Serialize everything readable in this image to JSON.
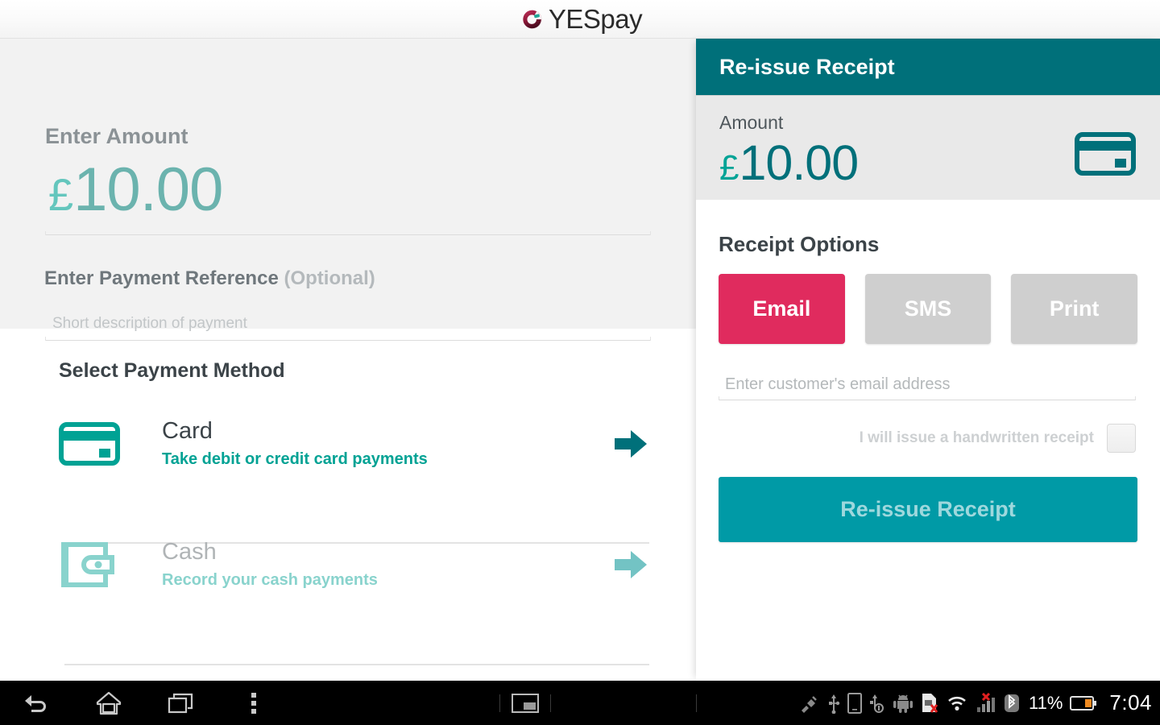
{
  "brand": {
    "logo_icon": "yespay-logo-icon",
    "name": "YESpay"
  },
  "left": {
    "amount_label": "Enter Amount",
    "amount_currency": "£",
    "amount_value": "10.00",
    "reference_label": "Enter Payment Reference",
    "reference_optional": "(Optional)",
    "reference_placeholder": "Short description of payment",
    "reference_value": "",
    "select_method_label": "Select Payment Method",
    "methods": [
      {
        "icon": "credit-card-icon",
        "title": "Card",
        "subtitle": "Take debit or credit card payments",
        "arrow_icon": "arrow-right-icon",
        "enabled": true,
        "color": "#00a294"
      },
      {
        "icon": "wallet-icon",
        "title": "Cash",
        "subtitle": "Record your cash payments",
        "arrow_icon": "arrow-right-icon",
        "enabled": false,
        "color": "#89d3cd"
      }
    ]
  },
  "right": {
    "header_title": "Re-issue Receipt",
    "amount_label": "Amount",
    "amount_currency": "£",
    "amount_value": "10.00",
    "card_icon": "credit-card-icon",
    "options_label": "Receipt Options",
    "options": [
      {
        "label": "Email",
        "selected": true
      },
      {
        "label": "SMS",
        "selected": false
      },
      {
        "label": "Print",
        "selected": false
      }
    ],
    "email_placeholder": "Enter customer's email address",
    "email_value": "",
    "handwritten_label": "I will issue a handwritten receipt",
    "handwritten_checked": false,
    "submit_label": "Re-issue Receipt"
  },
  "system_bar": {
    "nav": [
      {
        "icon": "back-icon",
        "label": "Back"
      },
      {
        "icon": "home-icon",
        "label": "Home"
      },
      {
        "icon": "recents-icon",
        "label": "Recent apps"
      },
      {
        "icon": "overflow-menu-icon",
        "label": "Menu"
      }
    ],
    "mid_icon": "screenshot-icon",
    "status_icons": [
      "plug-icon",
      "usb-icon",
      "tablet-icon",
      "usb-debug-icon",
      "android-icon",
      "sim-error-icon",
      "wifi-icon",
      "signal-error-icon",
      "bluetooth-icon"
    ],
    "battery_percent": "11%",
    "battery_icon": "battery-icon",
    "clock": "7:04"
  },
  "colors": {
    "brand_teal_dark": "#00707a",
    "brand_teal": "#009aa6",
    "accent_green": "#00a294",
    "accent_pink": "#e02b5e",
    "logo_maroon": "#8e1838",
    "muted_teal": "#6bb3ae",
    "light_teal": "#89d3cd",
    "panel_grey": "#f2f2f2",
    "amount_box_grey": "#e9e9e9",
    "text_dark": "#3b4348",
    "text_muted": "#8b9296",
    "disabled_grey": "#cfcfcf"
  }
}
